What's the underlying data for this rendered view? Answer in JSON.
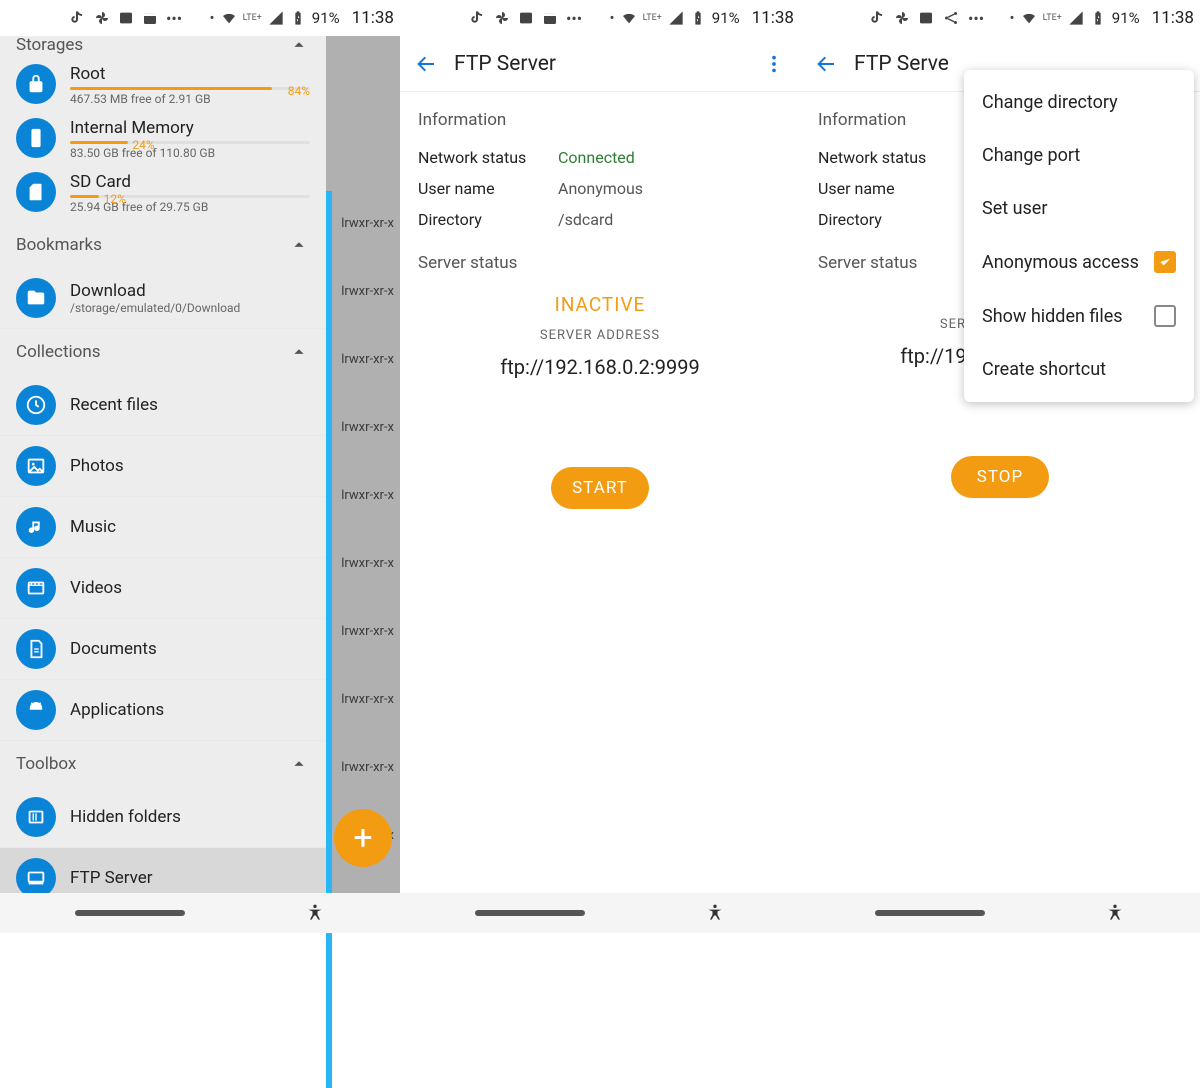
{
  "statusbar": {
    "battery": "91%",
    "clock": "11:38",
    "lte": "LTE+"
  },
  "screen1": {
    "storages_header": "Storages",
    "storages": [
      {
        "name": "Root",
        "pct": "84%",
        "pctw": 84,
        "sub": "467.53 MB free of 2.91 GB"
      },
      {
        "name": "Internal Memory",
        "pct": "24%",
        "pctw": 24,
        "sub": "83.50 GB free of 110.80 GB"
      },
      {
        "name": "SD Card",
        "pct": "12%",
        "pctw": 12,
        "sub": "25.94 GB free of 29.75 GB"
      }
    ],
    "bookmarks_header": "Bookmarks",
    "bookmarks": [
      {
        "label": "Download",
        "sub": "/storage/emulated/0/Download"
      }
    ],
    "collections_header": "Collections",
    "collections": [
      {
        "label": "Recent files"
      },
      {
        "label": "Photos"
      },
      {
        "label": "Music"
      },
      {
        "label": "Videos"
      },
      {
        "label": "Documents"
      },
      {
        "label": "Applications"
      }
    ],
    "toolbox_header": "Toolbox",
    "toolbox": [
      {
        "label": "Hidden folders"
      },
      {
        "label": "FTP Server"
      }
    ],
    "perm": "lrwxr-xr-x"
  },
  "ftp": {
    "title": "FTP Server",
    "information": "Information",
    "rows": {
      "netstatus_k": "Network status",
      "netstatus_v": "Connected",
      "user_k": "User name",
      "user_v": "Anonymous",
      "dir_k": "Directory",
      "dir_v": "/sdcard"
    },
    "server_status": "Server status",
    "inactive": "INACTIVE",
    "addr_label": "SERVER ADDRESS",
    "addr": "ftp://192.168.0.2:9999",
    "start": "START",
    "stop": "STOP",
    "title_cut": "FTP Serve"
  },
  "menu": {
    "items": [
      "Change directory",
      "Change port",
      "Set user",
      "Anonymous access",
      "Show hidden files",
      "Create shortcut"
    ]
  }
}
